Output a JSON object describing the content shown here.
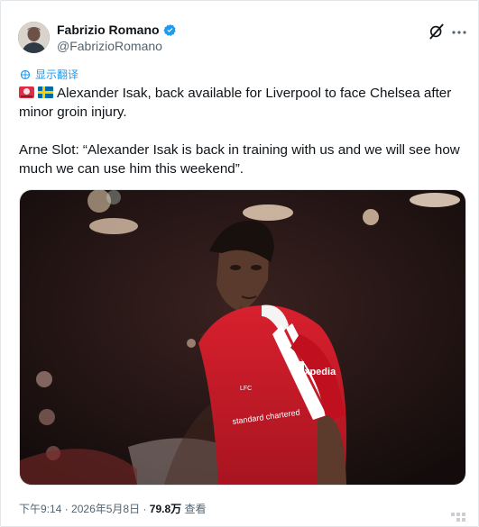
{
  "author": {
    "name": "Fabrizio Romano",
    "handle": "@FabrizioRomano"
  },
  "translate_label": "显示翻译",
  "tweet": {
    "line1": "Alexander Isak, back available for Liverpool to face Chelsea after minor groin injury.",
    "line2": "Arne Slot: “Alexander Isak is back in training with us and we will see how much we can use him this weekend”."
  },
  "media": {
    "shirt_brand": "Expedia",
    "shirt_crest": "LFC",
    "shirt_sponsor": "standard chartered"
  },
  "meta": {
    "time": "下午9:14",
    "date": "2026年5月8日",
    "views": "79.8万",
    "views_suffix": "查看",
    "separator": "·"
  },
  "colors": {
    "accent": "#1d9bf0",
    "text": "#0f1419",
    "muted": "#536471",
    "liverpool_red": "#c8102e"
  },
  "icons": [
    "verified-badge-icon",
    "grok-icon",
    "more-icon",
    "translate-icon",
    "red-alert-emoji-icon",
    "sweden-flag-icon"
  ]
}
